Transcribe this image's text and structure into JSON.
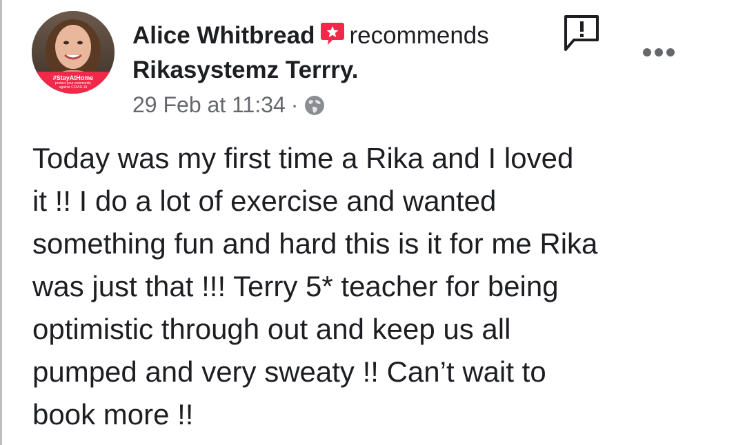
{
  "post": {
    "author": "Alice Whitbread",
    "action": "recommends",
    "page": "Rikasystemz Terrry.",
    "timestamp": "29 Feb at 11:34",
    "separator": "·",
    "privacy_icon": "globe-icon",
    "body_lines": [
      "Today was my first time a Rika and I loved",
      "it !! I do a lot of exercise and wanted",
      "something fun and hard this is it for me Rika",
      "was just that !!! Terry 5* teacher for being",
      "optimistic through out and keep us all",
      "pumped and very sweaty !! Can’t wait to",
      "book more !!"
    ],
    "avatar_frame": {
      "text": "#StayAtHome",
      "subtext": "protect your community against COVID-19"
    }
  },
  "icons": {
    "recommend": "recommend-icon",
    "report": "report-icon",
    "more": "more-options-icon"
  },
  "colors": {
    "recommend_accent": "#f0284a",
    "meta_text": "#65676b",
    "body_text": "#1c1e21"
  }
}
